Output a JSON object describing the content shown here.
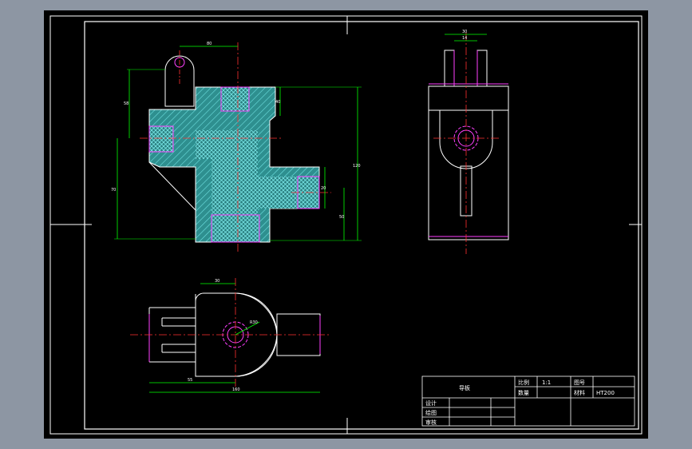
{
  "title_block": {
    "name": "导板",
    "scale_label": "比例",
    "scale_value": "1:1",
    "drawing_no_label": "图号",
    "quantity_label": "数量",
    "material_label": "材料",
    "material_value": "HT200",
    "designer_label": "设计",
    "drafter_label": "绘图",
    "checker_label": "审核"
  },
  "dimensions": {
    "front_top_width": "80",
    "front_height_upper": "58",
    "front_height_lower": "70",
    "front_total_height": "120",
    "front_right_small": "40",
    "front_right_hole": "20",
    "front_right_height": "50",
    "side_top_width": "30",
    "side_inner_width": "14",
    "plan_top_width": "30",
    "plan_overall": "160",
    "plan_partial": "55",
    "plan_radius": "R30"
  },
  "colors": {
    "background": "#000000",
    "outline": "#ffffff",
    "dimension": "#00ff00",
    "centerline": "#ff3030",
    "hidden": "#ff40ff",
    "hatch_a": "#3aa0a0",
    "hatch_b": "#5fd0d0",
    "frame": "#ffffff"
  }
}
